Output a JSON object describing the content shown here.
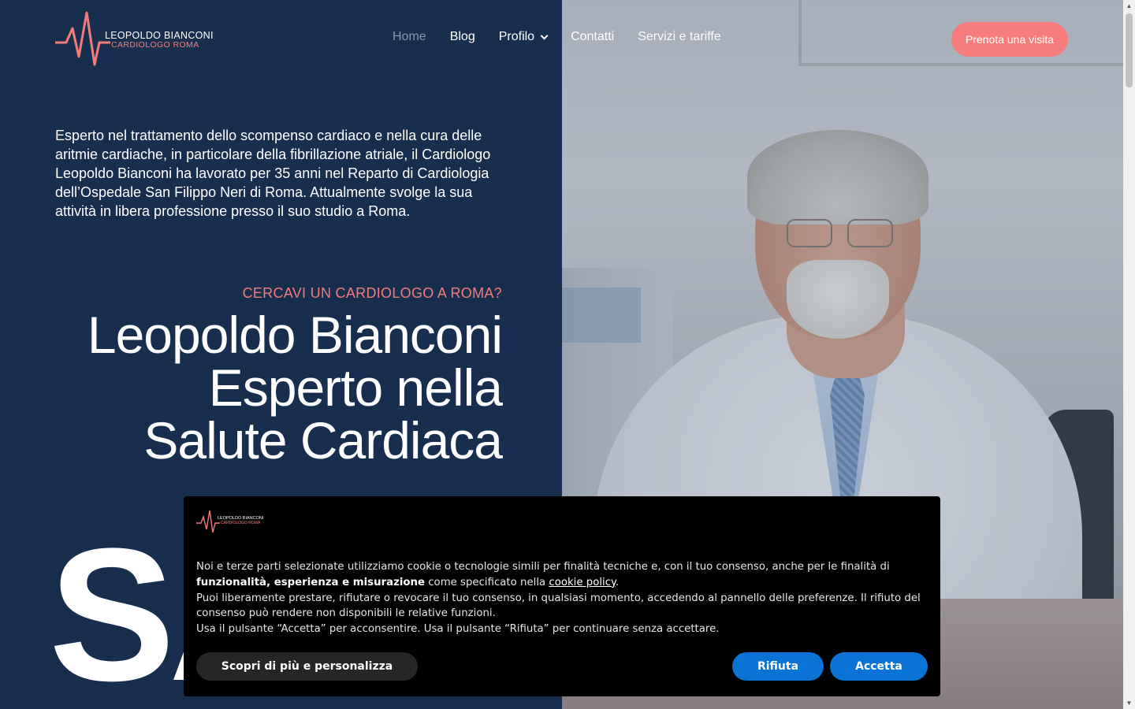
{
  "logo": {
    "line1": "LEOPOLDO BIANCONI",
    "line2": "CARDIOLOGO ROMA"
  },
  "nav": {
    "items": [
      {
        "label": "Home",
        "active": true
      },
      {
        "label": "Blog"
      },
      {
        "label": "Profilo",
        "has_dropdown": true
      },
      {
        "label": "Contatti"
      },
      {
        "label": "Servizi e tariffe"
      }
    ],
    "cta_label": "Prenota una visita"
  },
  "hero": {
    "intro": "Esperto nel trattamento dello scompenso cardiaco e nella cura delle aritmie cardiache, in particolare della fibrillazione atriale, il Cardiologo Leopoldo Bianconi ha lavorato per 35 anni nel Reparto di Cardiologia dell’Ospedale San Filippo Neri di Roma. Attualmente svolge la sua attività in libera professione presso il suo studio a Roma.",
    "kicker": "CERCAVI UN CARDIOLOGO A ROMA?",
    "title": "Leopoldo Bianconi Esperto nella Salute Cardiaca",
    "big_text": "SA"
  },
  "cookie": {
    "logo_line1": "LEOPOLDO BIANCONI",
    "logo_line2": "CARDIOLOGO ROMA",
    "p1_start": "Noi e terze parti selezionate utilizziamo cookie o tecnologie simili per finalità tecniche e, con il tuo consenso, anche per le finalità di ",
    "p1_bold": "funzionalità, esperienza e misurazione",
    "p1_mid": " come specificato nella ",
    "p1_link": "cookie policy",
    "p1_end": ".",
    "p2": "Puoi liberamente prestare, rifiutare o revocare il tuo consenso, in qualsiasi momento, accedendo al pannello delle preferenze. Il rifiuto del consenso può rendere non disponibili le relative funzioni.",
    "p3": "Usa il pulsante “Accetta” per acconsentire. Usa il pulsante “Rifiuta” per continuare senza accettare.",
    "more_label": "Scopri di più e personalizza",
    "reject_label": "Rifiuta",
    "accept_label": "Accetta"
  },
  "colors": {
    "navy": "#172e4f",
    "coral": "#f77c7c",
    "cookie_blue": "#0b73d6"
  }
}
